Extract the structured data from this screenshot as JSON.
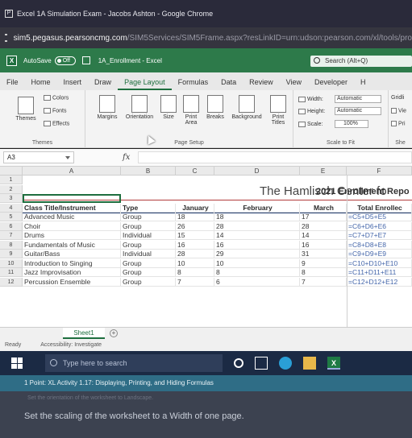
{
  "window": {
    "title": "Excel 1A Simulation Exam - Jacobs Ashton - Google Chrome",
    "logo": "P"
  },
  "address": {
    "host": "sim5.pegasus.pearsoncmg.com",
    "path": "/SIM5Services/SIM5Frame.aspx?resLinkID=urn:udson:pearson.com/xl/tools/pro"
  },
  "qat": {
    "autosave": "AutoSave",
    "toggle": "Off",
    "filename": "1A_Enrollment - Excel",
    "search": "Search (Alt+Q)",
    "app_icon": "X"
  },
  "tabs": [
    "File",
    "Home",
    "Insert",
    "Draw",
    "Page Layout",
    "Formulas",
    "Data",
    "Review",
    "View",
    "Developer",
    "H"
  ],
  "ribbon": {
    "themes": {
      "btn": "Themes",
      "colors": "Colors",
      "fonts": "Fonts",
      "effects": "Effects",
      "label": "Themes"
    },
    "page_setup": {
      "margins": "Margins",
      "orientation": "Orientation",
      "size": "Size",
      "print_area": "Print Area",
      "breaks": "Breaks",
      "background": "Background",
      "print_titles": "Print Titles",
      "label": "Page Setup"
    },
    "scale": {
      "width_label": "Width:",
      "width_value": "Automatic",
      "height_label": "Height:",
      "height_value": "Automatic",
      "scale_label": "Scale:",
      "scale_value": "100%",
      "label": "Scale to Fit"
    },
    "sheet_opts": {
      "gridlines": "Gridli",
      "view": "Vie",
      "print": "Pri",
      "label": "She"
    }
  },
  "formula_bar": {
    "name_box": "A3",
    "fx": "fx"
  },
  "grid": {
    "columns": [
      "A",
      "B",
      "C",
      "D",
      "E",
      "F"
    ],
    "row_numbers": [
      "1",
      "2",
      "3",
      "4",
      "5",
      "6",
      "7",
      "8",
      "9",
      "10",
      "11",
      "12"
    ],
    "title": "The Hamlisch Center fo",
    "subtitle": "2021 Enrollment Repo",
    "headers": {
      "a": "Class Title/Instrument",
      "b": "Type",
      "c": "January",
      "d": "February",
      "e": "March",
      "f": "Total Enrollec"
    },
    "rows": [
      {
        "a": "Advanced Music",
        "b": "Group",
        "c": "18",
        "d": "18",
        "e": "17",
        "f": "=C5+D5+E5"
      },
      {
        "a": "Choir",
        "b": "Group",
        "c": "26",
        "d": "28",
        "e": "28",
        "f": "=C6+D6+E6"
      },
      {
        "a": "Drums",
        "b": "Individual",
        "c": "15",
        "d": "14",
        "e": "14",
        "f": "=C7+D7+E7"
      },
      {
        "a": "Fundamentals of Music",
        "b": "Group",
        "c": "16",
        "d": "16",
        "e": "16",
        "f": "=C8+D8+E8"
      },
      {
        "a": "Guitar/Bass",
        "b": "Individual",
        "c": "28",
        "d": "29",
        "e": "31",
        "f": "=C9+D9+E9"
      },
      {
        "a": "Introduction to Singing",
        "b": "Group",
        "c": "10",
        "d": "10",
        "e": "9",
        "f": "=C10+D10+E10"
      },
      {
        "a": "Jazz Improvisation",
        "b": "Group",
        "c": "8",
        "d": "8",
        "e": "8",
        "f": "=C11+D11+E11"
      },
      {
        "a": "Percussion Ensemble",
        "b": "Group",
        "c": "7",
        "d": "6",
        "e": "7",
        "f": "=C12+D12+E12"
      }
    ]
  },
  "sheet_tab": {
    "name": "Sheet1",
    "add": "+"
  },
  "status": {
    "ready": "Ready",
    "accessibility": "Accessibility: Investigate"
  },
  "taskbar": {
    "search": "Type here to search"
  },
  "instructions": {
    "header": "1 Point: XL Activity 1.17: Displaying, Printing, and Hiding Formulas",
    "previous": "Set the orientation of the worksheet to Landscape.",
    "task": "Set the scaling of the worksheet to a Width of one page."
  }
}
